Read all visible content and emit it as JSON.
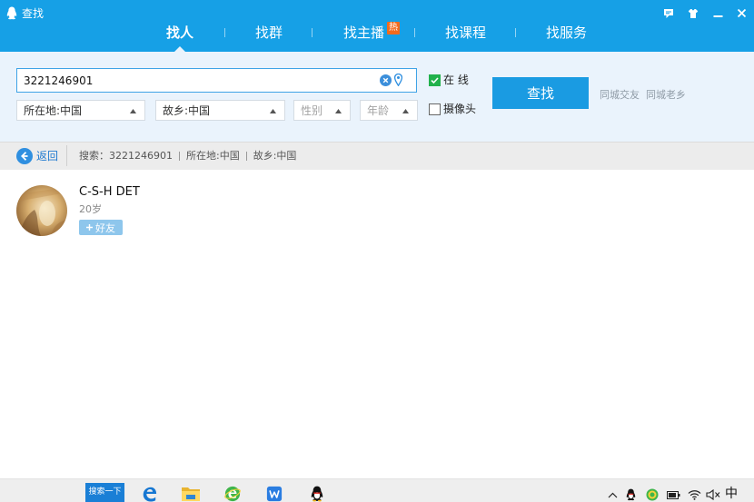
{
  "window": {
    "title": "查找",
    "icon": "qq-penguin-icon",
    "controls": [
      "feedback-icon",
      "skin-icon",
      "minimize-icon",
      "close-icon"
    ]
  },
  "tabs": [
    {
      "label": "找人",
      "selected": true
    },
    {
      "label": "找群",
      "selected": false
    },
    {
      "label": "找主播",
      "selected": false,
      "badge": "热"
    },
    {
      "label": "找课程",
      "selected": false
    },
    {
      "label": "找服务",
      "selected": false
    }
  ],
  "search": {
    "value": "3221246901",
    "icons": [
      "clear-icon",
      "location-icon"
    ]
  },
  "filters": [
    {
      "label": "所在地:中国",
      "placeholder": false
    },
    {
      "label": "故乡:中国",
      "placeholder": false
    },
    {
      "label": "性别",
      "placeholder": true
    },
    {
      "label": "年龄",
      "placeholder": true
    }
  ],
  "options": {
    "online": {
      "label": "在 线",
      "checked": true
    },
    "camera": {
      "label": "摄像头",
      "checked": false
    }
  },
  "find_button": "查找",
  "links": {
    "local_friends": "同城交友",
    "hometown_friends": "同城老乡"
  },
  "breadcrumb": {
    "back_label": "返回",
    "prefix": "搜索：",
    "query": "3221246901",
    "location": "所在地:中国",
    "hometown": "故乡:中国"
  },
  "results": [
    {
      "name": "C-S-H DET",
      "age": "20岁",
      "add_label": "好友"
    }
  ],
  "taskbar": {
    "search_label": "搜索一下",
    "apps": [
      "edge-icon",
      "file-explorer-icon",
      "360-browser-icon",
      "wps-icon",
      "qq-icon"
    ],
    "tray": [
      "chevron-up-icon",
      "qq-tray-icon",
      "360-security-icon",
      "battery-icon",
      "wifi-icon",
      "volume-muted-icon"
    ],
    "ime": "中"
  },
  "colors": {
    "titlebar": "#16a0e6",
    "panel": "#eaf3fc",
    "accent": "#1a9be2",
    "badge": "#f26b1d",
    "checkbox": "#22b14c",
    "add_button": "#8ec6ec"
  }
}
